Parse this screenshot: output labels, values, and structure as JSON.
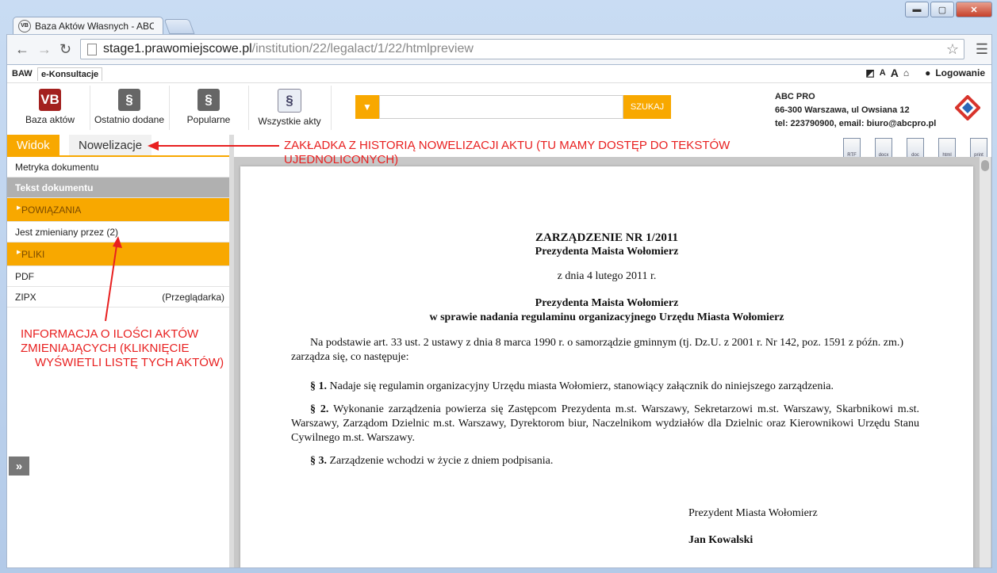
{
  "browser": {
    "tab_title": "Baza Aktów Własnych - ABC",
    "favicon": "VB",
    "url_host": "stage1.prawomiejscowe.pl",
    "url_path": "/institution/22/legalact/1/22/htmlpreview",
    "controls": {
      "minimize": "▬",
      "maximize": "▢",
      "close": "✕"
    }
  },
  "topbar": {
    "baw": "BAW",
    "ekonsultacje": "e-Konsultacje",
    "font_small": "A",
    "font_large": "A",
    "login": "Logowanie"
  },
  "header": {
    "buttons": [
      {
        "label": "Baza aktów",
        "icon": "VB"
      },
      {
        "label": "Ostatnio dodane",
        "icon": "§"
      },
      {
        "label": "Popularne",
        "icon": "§"
      },
      {
        "label": "Wszystkie akty",
        "icon": "§"
      }
    ],
    "search_placeholder": "",
    "search_button": "SZUKAJ",
    "contact": {
      "name": "ABC PRO",
      "address": "66-300 Warszawa, ul Owsiana 12",
      "tel": "tel: 223790900, email: biuro@abcpro.pl"
    }
  },
  "view_tabs": {
    "active": "Widok",
    "other": "Nowelizacje"
  },
  "sidebar": {
    "metryka": "Metryka dokumentu",
    "tekst": "Tekst dokumentu",
    "powiazania": "POWIĄZANIA",
    "zmieniany": "Jest zmieniany przez (2)",
    "pliki": "PLIKI",
    "pdf": "PDF",
    "zipx": "ZIPX",
    "przegladarka": "(Przeglądarka)",
    "expand": "»"
  },
  "doc_icons": [
    "RTF",
    "docx",
    "doc",
    "html",
    "print"
  ],
  "document": {
    "title": "ZARZĄDZENIE NR 1/2011",
    "issuer": "Prezydenta Maista Wołomierz",
    "date": "z dnia 4 lutego 2011 r.",
    "subject_1": "Prezydenta Maista Wołomierz",
    "subject_2": "w sprawie nadania regulaminu organizacyjnego Urzędu Miasta Wołomierz",
    "preamble": "Na podstawie art. 33 ust. 2 ustawy z dnia 8 marca 1990 r. o samorządzie gminnym (tj. Dz.U. z 2001 r. Nr 142, poz. 1591 z późn. zm.) zarządza się, co następuje:",
    "p1_label": "§ 1.",
    "p1_text": " Nadaje się regulamin organizacyjny Urzędu miasta Wołomierz, stanowiący załącznik do niniejszego zarządzenia.",
    "p2_label": "§ 2.",
    "p2_text": " Wykonanie zarządzenia powierza się Zastępcom Prezydenta m.st. Warszawy, Sekretarzowi m.st. Warszawy, Skarbnikowi m.st. Warszawy, Zarządom Dzielnic m.st. Warszawy, Dyrektorom biur, Naczelnikom wydziałów dla Dzielnic oraz Kierownikowi Urzędu Stanu Cywilnego m.st. Warszawy.",
    "p3_label": "§ 3.",
    "p3_text": " Zarządzenie wchodzi w życie z dniem podpisania.",
    "sign_role": "Prezydent Miasta Wołomierz",
    "sign_name": "Jan Kowalski"
  },
  "annotations": {
    "tab_note_1": "ZAKŁADKA Z HISTORIĄ NOWELIZACJI AKTU (TU MAMY DOSTĘP DO TEKSTÓW",
    "tab_note_2": "UJEDNOLICONYCH)",
    "count_note_1": "INFORMACJA O ILOŚCI AKTÓW",
    "count_note_2": "ZMIENIAJĄCYCH (KLIKNIĘCIE",
    "count_note_3": "WYŚWIETLI LISTĘ TYCH AKTÓW)"
  },
  "colors": {
    "accent": "#f8a800",
    "annotation": "#e81f1f"
  }
}
